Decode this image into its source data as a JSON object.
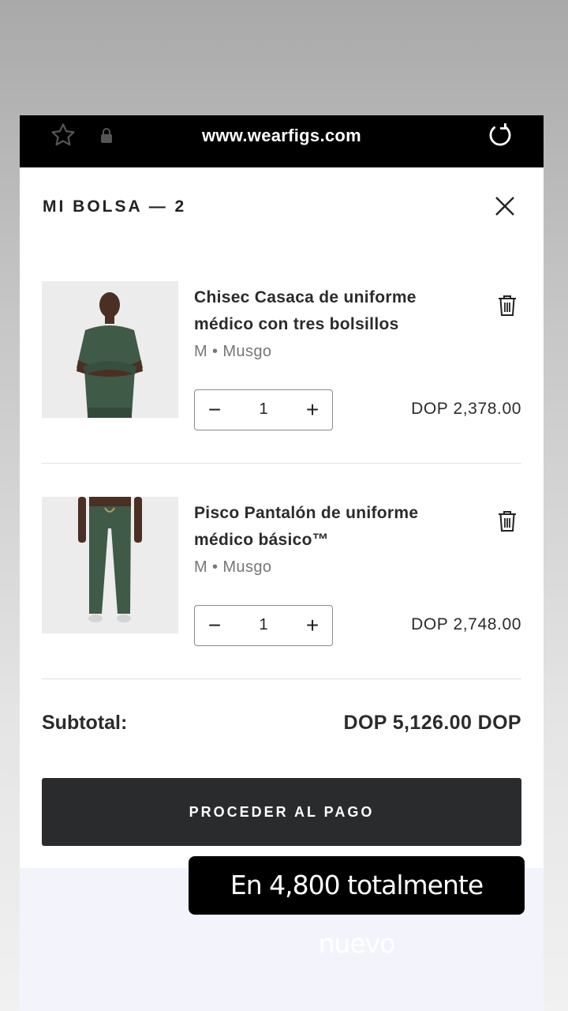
{
  "browser": {
    "url": "www.wearfigs.com",
    "icons": [
      "star-icon",
      "lock-icon",
      "reload-icon"
    ]
  },
  "bag": {
    "title": "MI BOLSA — 2",
    "close_icon": "close-icon"
  },
  "items": [
    {
      "name": "Chisec Casaca de uniforme médico con tres bolsillos",
      "variant": "M • Musgo",
      "quantity": "1",
      "price": "DOP 2,378.00",
      "minus": "−",
      "plus": "+"
    },
    {
      "name": "Pisco Pantalón de uniforme médico básico™",
      "variant": "M • Musgo",
      "quantity": "1",
      "price": "DOP 2,748.00",
      "minus": "−",
      "plus": "+"
    }
  ],
  "summary": {
    "subtotal_label": "Subtotal:",
    "subtotal_value": "DOP 5,126.00 DOP"
  },
  "checkout": {
    "label": "PROCEDER AL PAGO"
  },
  "overlay": {
    "caption": "En  4,800  totalmente nuevo"
  },
  "colors": {
    "scrub_green": "#3f5a47",
    "button_bg": "#2a2b2d"
  }
}
